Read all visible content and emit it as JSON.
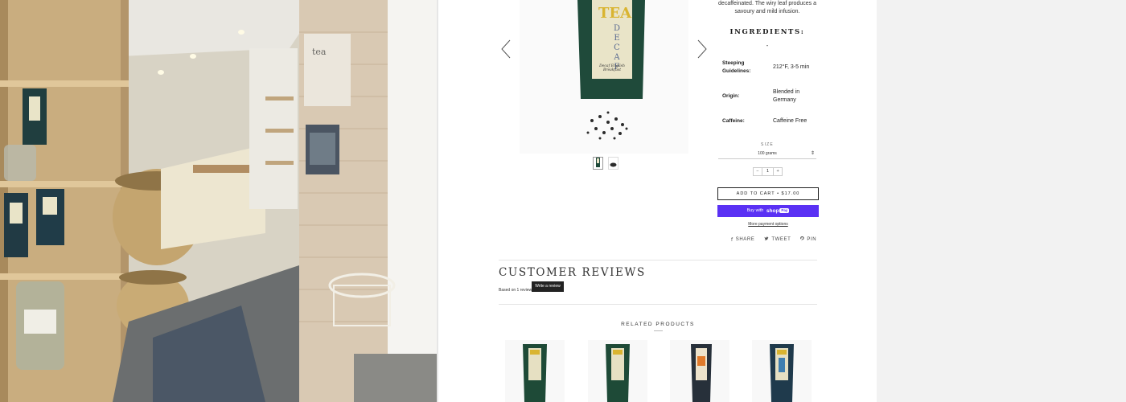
{
  "product": {
    "description_fragment": "decaffeinated. The wiry leaf produces a savoury and mild infusion.",
    "ingredients_title": "INGREDIENTS:",
    "ingredients_value": "-",
    "bag_label": "DECAF",
    "bag_brand": "TEA",
    "bag_subtitle": "Decaf English Breakfast",
    "specs": {
      "steeping_label": "Steeping Guidelines:",
      "steeping_value": "212°F, 3-5 min",
      "origin_label": "Origin:",
      "origin_value": "Blended in Germany",
      "caffeine_label": "Caffeine:",
      "caffeine_value": "Caffeine Free"
    },
    "size_label": "SIZE",
    "size_selected": "100 grams",
    "quantity": "1",
    "qty_minus": "−",
    "qty_plus": "+",
    "add_to_cart": "ADD TO CART • $17.00",
    "buy_with": "Buy with",
    "shop_label": "shop",
    "pay_label": "Pay",
    "more_payment": "More payment options"
  },
  "social": {
    "share": "SHARE",
    "tweet": "TWEET",
    "pin": "PIN",
    "share_icon": "f",
    "tweet_icon": "bird-icon",
    "pin_icon": "pinterest-icon"
  },
  "reviews": {
    "title": "CUSTOMER REVIEWS",
    "based_on": "Based on 1 review",
    "write_review": "Write a review"
  },
  "related": {
    "title": "RELATED PRODUCTS"
  },
  "store_photo": {
    "sign_text": "tea"
  },
  "colors": {
    "tea_bag": "#1f4a3a",
    "label_cream": "#e9e4c8",
    "shop_pay": "#5a31f4"
  }
}
